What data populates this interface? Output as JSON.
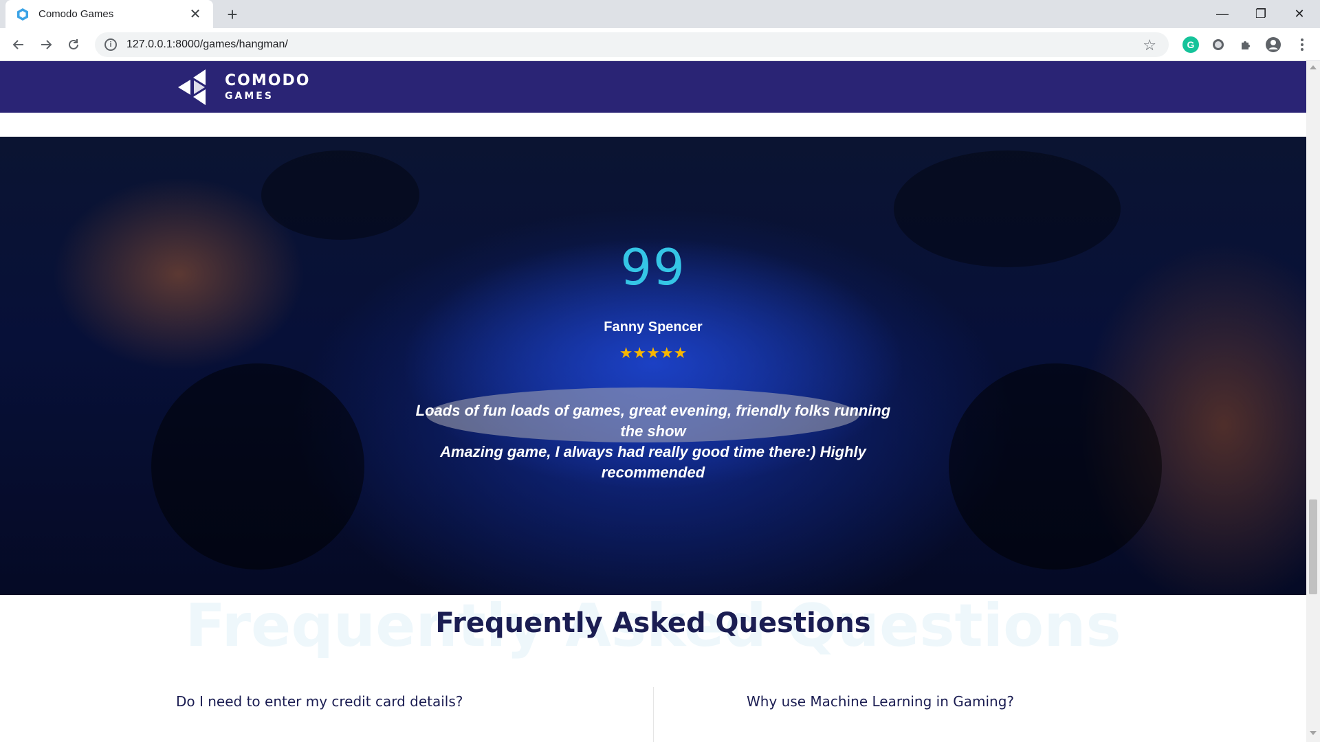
{
  "browser": {
    "tab_title": "Comodo Games",
    "tab_close": "✕",
    "new_tab": "+",
    "url": "127.0.0.1:8000/games/hangman/",
    "window_controls": {
      "minimize": "—",
      "restore": "❐",
      "close": "✕"
    }
  },
  "site": {
    "logo_top": "COMODO",
    "logo_bottom": "GAMES",
    "header_color": "#2a2475"
  },
  "testimonial": {
    "quote_mark": "99",
    "reviewer": "Fanny Spencer",
    "stars": "★★★★★",
    "rating": 5,
    "text_line1": "Loads of fun loads of games, great evening, friendly folks running the show",
    "text_line2": "Amazing game, I always had really good time there:) Highly recommended"
  },
  "faq": {
    "background_title": "Frequently Asked Questions",
    "title": "Frequently Asked Questions",
    "questions": [
      "Do I need to enter my credit card details?",
      "Why use Machine Learning in Gaming?"
    ]
  },
  "colors": {
    "accent_cyan": "#35c6e6",
    "star": "#f7b500",
    "heading": "#1b1d52"
  },
  "icons": {
    "favicon": "comodo-favicon-icon",
    "back": "back-arrow-icon",
    "forward": "forward-arrow-icon",
    "reload": "reload-icon",
    "info": "info-icon",
    "bookmark": "star-icon",
    "grammarly": "grammarly-icon",
    "extension_circle": "circle-extension-icon",
    "extensions": "puzzle-icon",
    "profile": "profile-icon",
    "menu": "kebab-menu-icon"
  }
}
